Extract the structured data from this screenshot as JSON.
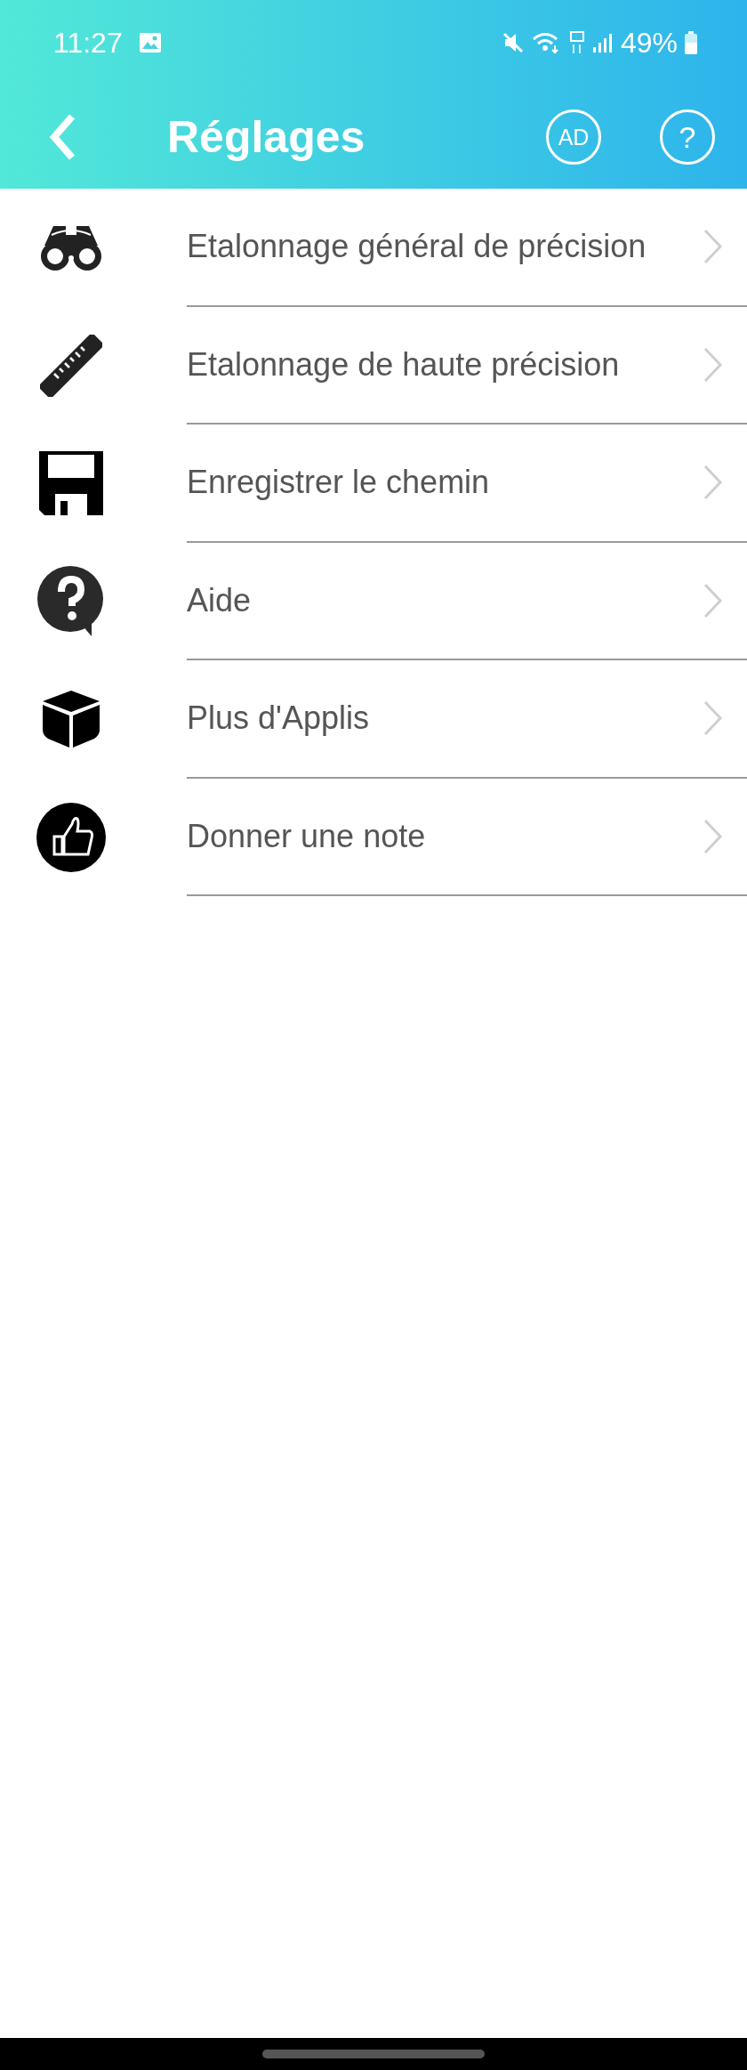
{
  "status_bar": {
    "time": "11:27",
    "battery": "49%"
  },
  "header": {
    "title": "Réglages",
    "ad_button": "AD",
    "help_button": "?"
  },
  "menu": [
    {
      "label": "Etalonnage général de précision"
    },
    {
      "label": "Etalonnage de haute précision"
    },
    {
      "label": "Enregistrer le chemin"
    },
    {
      "label": "Aide"
    },
    {
      "label": "Plus d'Applis"
    },
    {
      "label": "Donner une note"
    }
  ]
}
